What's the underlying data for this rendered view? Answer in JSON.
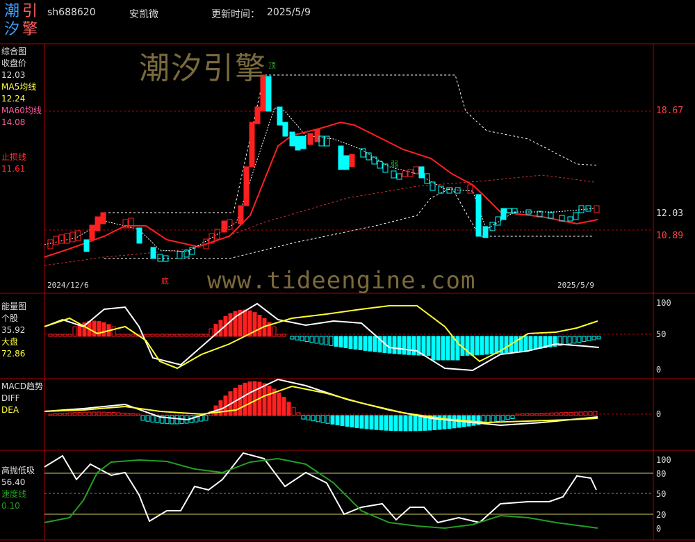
{
  "header": {
    "logo_chars": [
      "潮",
      "引",
      "汐",
      "擎"
    ],
    "code": "sh688620",
    "name": "安凯微",
    "update_label": "更新时间：",
    "update_date": "2025/5/9"
  },
  "watermarks": {
    "brand": "潮汐引擎",
    "url": "www.tideengine.com"
  },
  "panel_main": {
    "title": "综合图",
    "close_label": "收盘价",
    "close_value": "12.03",
    "ma5_label": "MA5均线",
    "ma5_value": "12.24",
    "ma60_label": "MA60均线",
    "ma60_value": "14.08",
    "stop_label": "止损线",
    "stop_value": "11.61",
    "axis_levels": [
      "18.67",
      "12.03",
      "10.89"
    ],
    "date_start": "2024/12/6",
    "date_end": "2025/5/9",
    "mark_top": "顶",
    "mark_bottom": "底",
    "mark_weak": "弱"
  },
  "panel_energy": {
    "title": "能量图",
    "stock_label": "个股",
    "stock_value": "35.92",
    "market_label": "大盘",
    "market_value": "72.86",
    "axis": [
      "100",
      "50",
      "0"
    ]
  },
  "panel_macd": {
    "title": "MACD趋势",
    "diff_label": "DIFF",
    "dea_label": "DEA",
    "axis": [
      "0"
    ]
  },
  "panel_hilo": {
    "title": "高抛低吸",
    "value": "56.40",
    "speed_label": "速度线",
    "speed_value": "0.10",
    "axis": [
      "100",
      "80",
      "50",
      "20",
      "0"
    ]
  },
  "colors": {
    "up": "#ff2020",
    "down": "#00ffff",
    "grid": "#a00000",
    "ma5": "#ffffff",
    "ma60": "#ff3b3b",
    "label_yellow": "#ffff40",
    "label_red": "#ff3030",
    "label_pink": "#ff5aa0",
    "speed_green": "#22a022"
  }
}
